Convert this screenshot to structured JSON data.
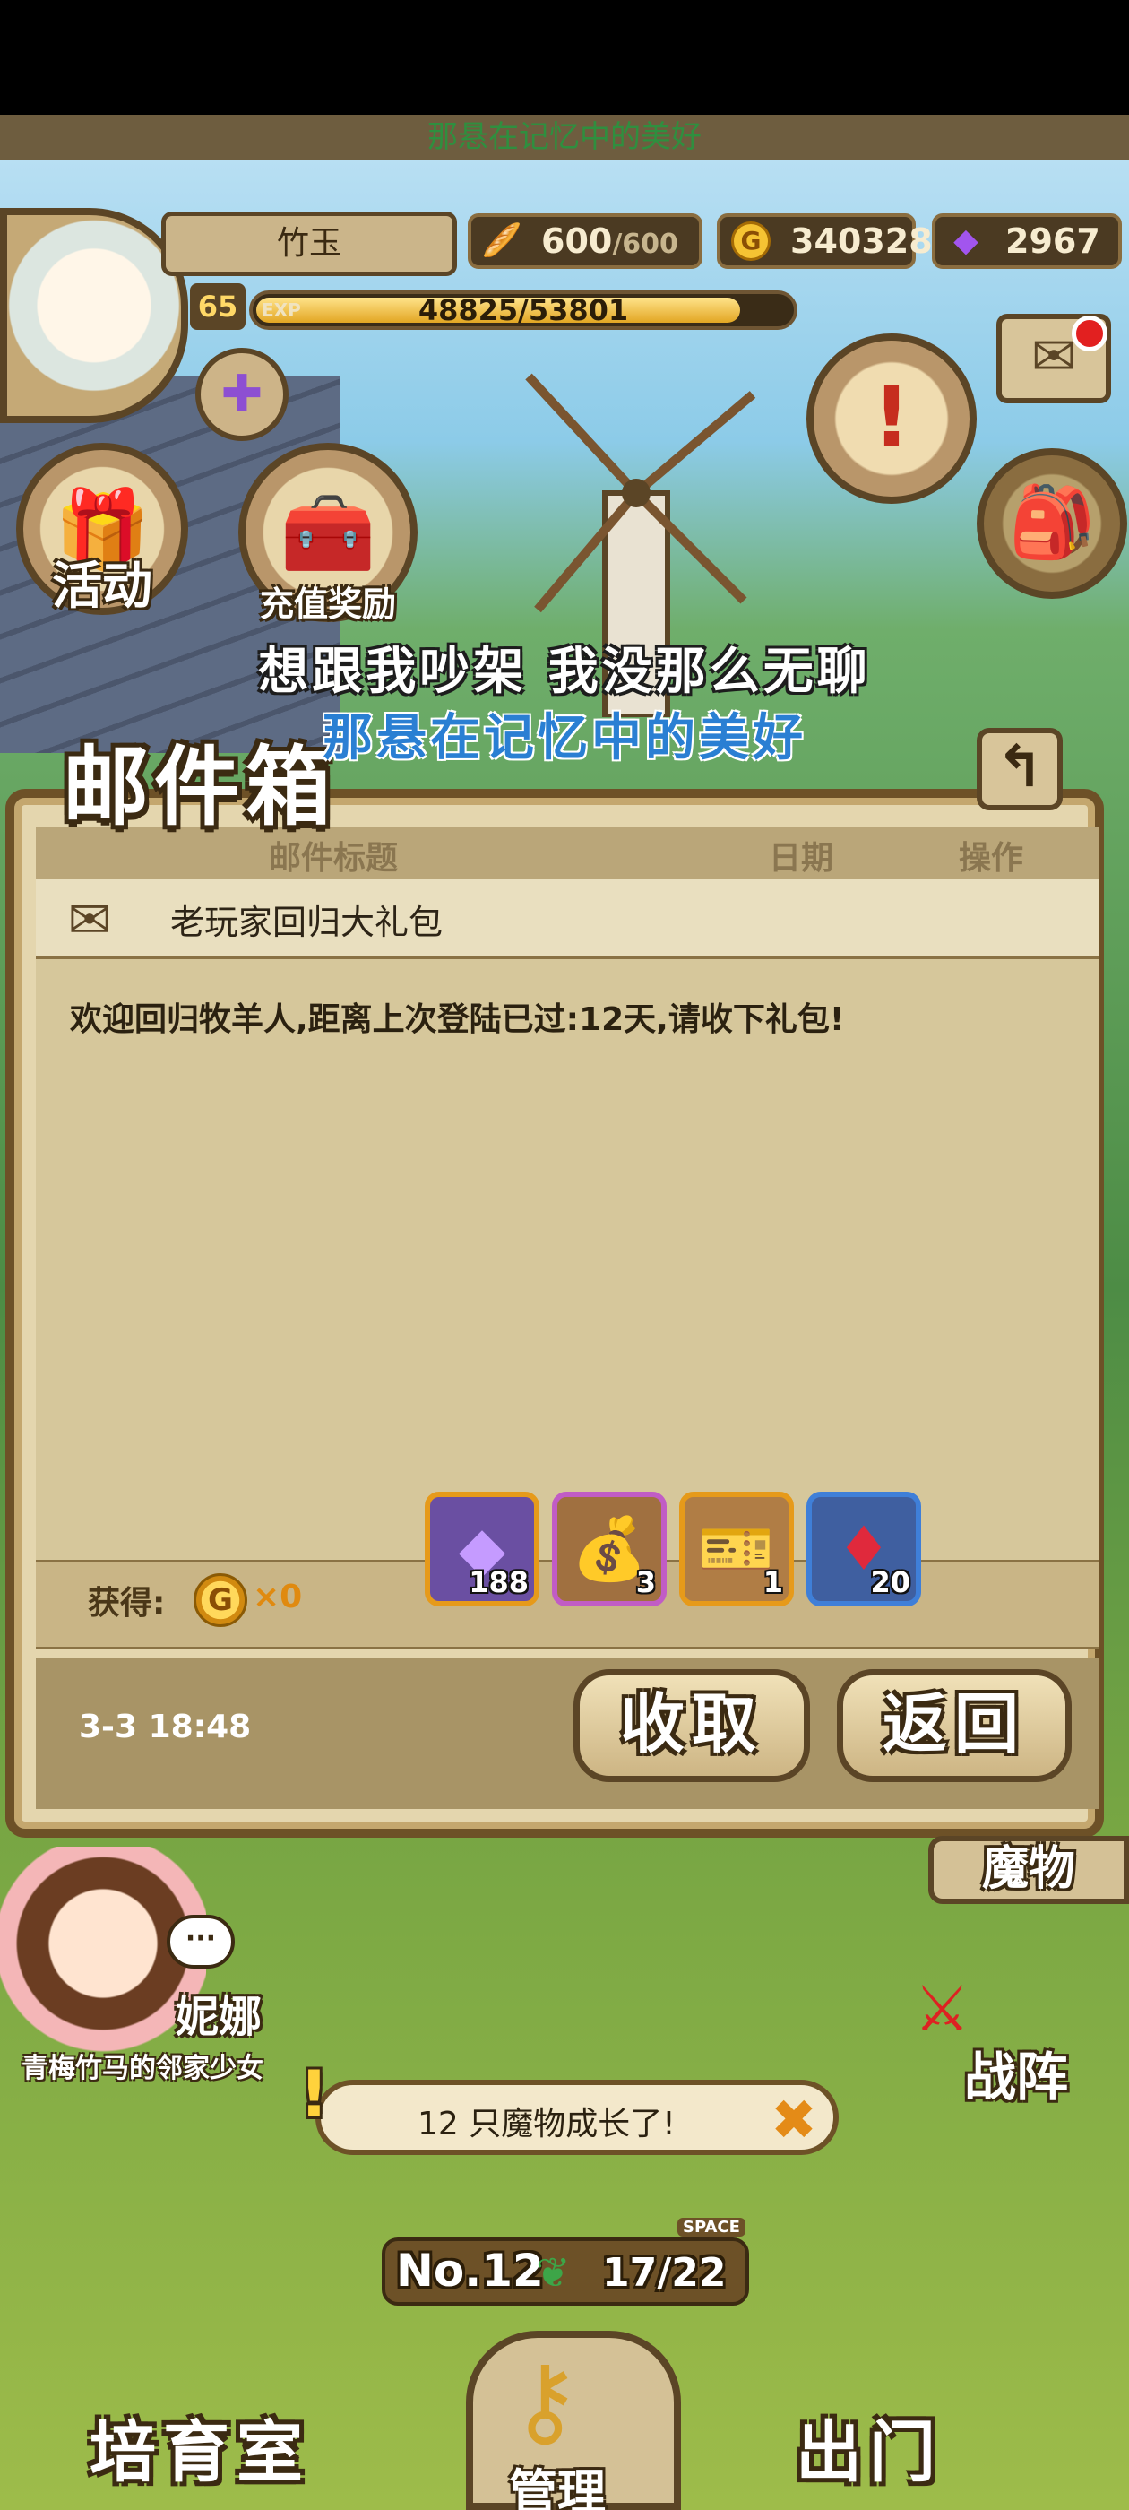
{
  "lyrics": {
    "top": "那悬在记忆中的美好",
    "mid_line1": "想跟我吵架 我没那么无聊",
    "mid_line2": "那悬在记忆中的美好"
  },
  "player": {
    "name": "竹玉",
    "level": "65",
    "exp_label": "EXP",
    "exp_text": "48825/53801",
    "exp_fraction": 0.9075
  },
  "resources": {
    "stamina_current": "600",
    "stamina_max": "/600",
    "gold": "340328",
    "gems": "2967"
  },
  "left_buttons": {
    "events": "活动",
    "recharge": "充值奖励"
  },
  "mailbox": {
    "title": "邮件箱",
    "columns": [
      "邮件标题",
      "日期",
      "操作"
    ],
    "subject": "老玩家回归大礼包",
    "body": "欢迎回归牧羊人,距离上次登陆已过:12天,请收下礼包!",
    "reward_label": "获得:",
    "coin_glyph": "G",
    "gold_count": "×0",
    "items": [
      {
        "icon": "purple-gem-icon",
        "qty": "188",
        "frame": "#e69a1a"
      },
      {
        "icon": "feed-bag-icon",
        "qty": "3",
        "frame": "#c15cc5"
      },
      {
        "icon": "ticket-icon",
        "qty": "1",
        "frame": "#e69a1a"
      },
      {
        "icon": "red-gem-icon",
        "qty": "20",
        "frame": "#3f7fd8"
      }
    ],
    "date": "3-3 18:48",
    "collect_label": "收取",
    "back_label": "返回"
  },
  "scene": {
    "npc_name": "妮娜",
    "npc_subtitle": "青梅竹马的邻家少女",
    "speech": "···",
    "monster_tab": "魔物",
    "battle_label": "战阵",
    "notice": "12 只魔物成长了!",
    "counter_no": "No.12",
    "counter_val": "17/22",
    "counter_space": "SPACE",
    "nav_nursery": "培育室",
    "nav_manage": "管理",
    "nav_exit": "出门"
  }
}
